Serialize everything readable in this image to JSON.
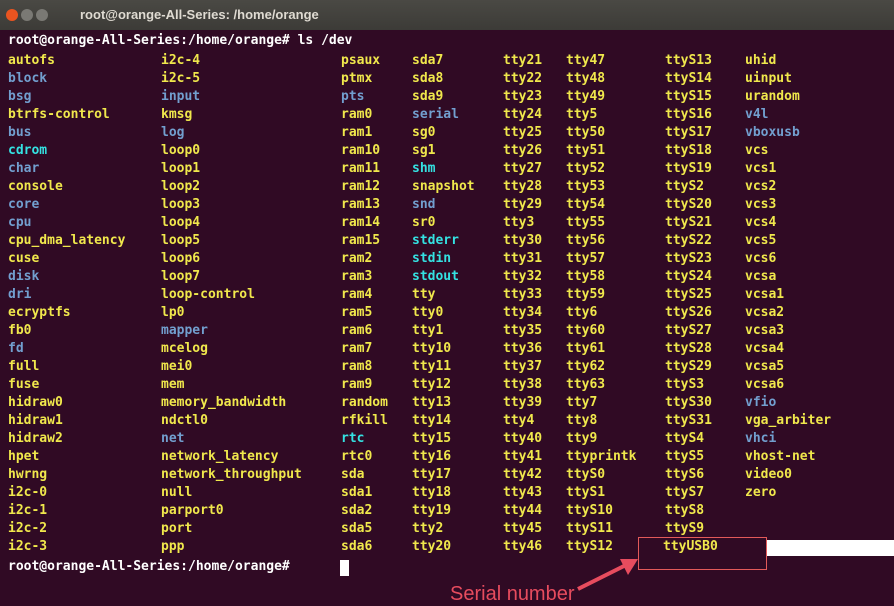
{
  "window": {
    "title": "root@orange-All-Series: /home/orange"
  },
  "terminal": {
    "command_line": "root@orange-All-Series:/home/orange# ls /dev",
    "prompt": "root@orange-All-Series:/home/orange# ",
    "columns": [
      [
        "autofs",
        "block",
        "bsg",
        "btrfs-control",
        "bus",
        "cdrom",
        "char",
        "console",
        "core",
        "cpu",
        "cpu_dma_latency",
        "cuse",
        "disk",
        "dri",
        "ecryptfs",
        "fb0",
        "fd",
        "full",
        "fuse",
        "hidraw0",
        "hidraw1",
        "hidraw2",
        "hpet",
        "hwrng",
        "i2c-0",
        "i2c-1",
        "i2c-2",
        "i2c-3"
      ],
      [
        "i2c-4",
        "i2c-5",
        "input",
        "kmsg",
        "log",
        "loop0",
        "loop1",
        "loop2",
        "loop3",
        "loop4",
        "loop5",
        "loop6",
        "loop7",
        "loop-control",
        "lp0",
        "mapper",
        "mcelog",
        "mei0",
        "mem",
        "memory_bandwidth",
        "ndctl0",
        "net",
        "network_latency",
        "network_throughput",
        "null",
        "parport0",
        "port",
        "ppp"
      ],
      [
        "psaux",
        "ptmx",
        "pts",
        "ram0",
        "ram1",
        "ram10",
        "ram11",
        "ram12",
        "ram13",
        "ram14",
        "ram15",
        "ram2",
        "ram3",
        "ram4",
        "ram5",
        "ram6",
        "ram7",
        "ram8",
        "ram9",
        "random",
        "rfkill",
        "rtc",
        "rtc0",
        "sda",
        "sda1",
        "sda2",
        "sda5",
        "sda6"
      ],
      [
        "sda7",
        "sda8",
        "sda9",
        "serial",
        "sg0",
        "sg1",
        "shm",
        "snapshot",
        "snd",
        "sr0",
        "stderr",
        "stdin",
        "stdout",
        "tty",
        "tty0",
        "tty1",
        "tty10",
        "tty11",
        "tty12",
        "tty13",
        "tty14",
        "tty15",
        "tty16",
        "tty17",
        "tty18",
        "tty19",
        "tty2",
        "tty20"
      ],
      [
        "tty21",
        "tty22",
        "tty23",
        "tty24",
        "tty25",
        "tty26",
        "tty27",
        "tty28",
        "tty29",
        "tty3",
        "tty30",
        "tty31",
        "tty32",
        "tty33",
        "tty34",
        "tty35",
        "tty36",
        "tty37",
        "tty38",
        "tty39",
        "tty4",
        "tty40",
        "tty41",
        "tty42",
        "tty43",
        "tty44",
        "tty45",
        "tty46"
      ],
      [
        "tty47",
        "tty48",
        "tty49",
        "tty5",
        "tty50",
        "tty51",
        "tty52",
        "tty53",
        "tty54",
        "tty55",
        "tty56",
        "tty57",
        "tty58",
        "tty59",
        "tty6",
        "tty60",
        "tty61",
        "tty62",
        "tty63",
        "tty7",
        "tty8",
        "tty9",
        "ttyprintk",
        "ttyS0",
        "ttyS1",
        "ttyS10",
        "ttyS11",
        "ttyS12"
      ],
      [
        "ttyS13",
        "ttyS14",
        "ttyS15",
        "ttyS16",
        "ttyS17",
        "ttyS18",
        "ttyS19",
        "ttyS2",
        "ttyS20",
        "ttyS21",
        "ttyS22",
        "ttyS23",
        "ttyS24",
        "ttyS25",
        "ttyS26",
        "ttyS27",
        "ttyS28",
        "ttyS29",
        "ttyS3",
        "ttyS30",
        "ttyS31",
        "ttyS4",
        "ttyS5",
        "ttyS6",
        "ttyS7",
        "ttyS8",
        "ttyS9",
        "ttyUSB0"
      ],
      [
        "uhid",
        "uinput",
        "urandom",
        "v4l",
        "vboxusb",
        "vcs",
        "vcs1",
        "vcs2",
        "vcs3",
        "vcs4",
        "vcs5",
        "vcs6",
        "vcsa",
        "vcsa1",
        "vcsa2",
        "vcsa3",
        "vcsa4",
        "vcsa5",
        "vcsa6",
        "vfio",
        "vga_arbiter",
        "vhci",
        "vhost-net",
        "video0",
        "zero"
      ]
    ],
    "dir_entries": [
      "block",
      "bsg",
      "bus",
      "char",
      "core",
      "cpu",
      "disk",
      "dri",
      "fd",
      "input",
      "log",
      "mapper",
      "net",
      "pts",
      "serial",
      "snd",
      "v4l",
      "vboxusb",
      "vfio",
      "vhci"
    ],
    "link_entries": [
      "cdrom",
      "fd",
      "log",
      "rtc",
      "shm",
      "stderr",
      "stdin",
      "stdout",
      "core"
    ],
    "white_entries": []
  },
  "annotation": {
    "label": "Serial number",
    "color": "#e74c5e"
  }
}
